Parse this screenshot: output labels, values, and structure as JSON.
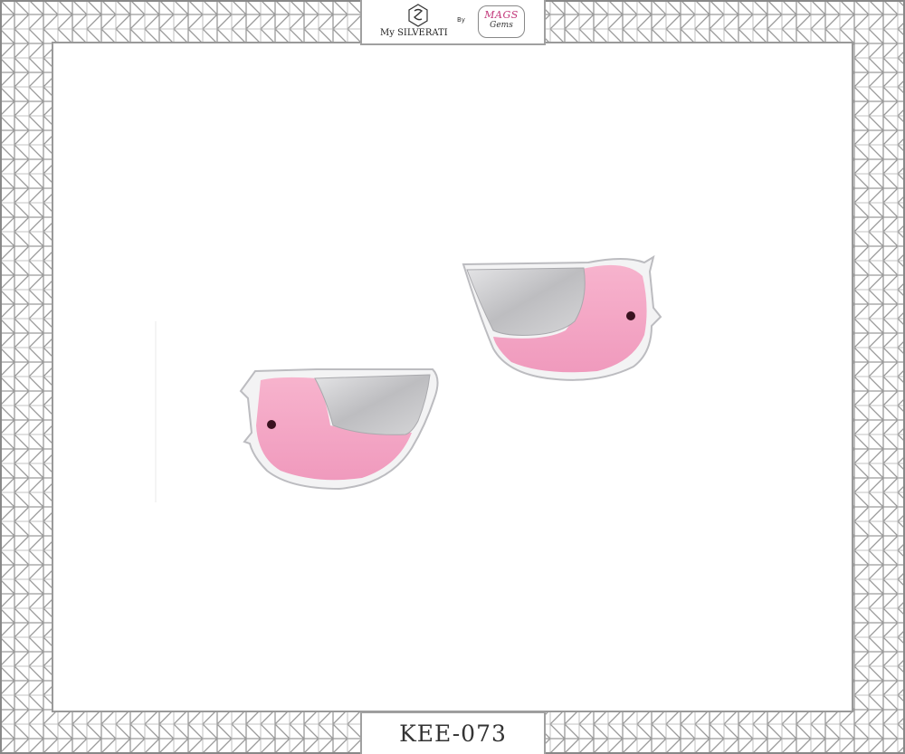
{
  "brand": {
    "name": "My SILVERATI",
    "by": "By",
    "partner_top": "MAGS",
    "partner_bottom": "Gems"
  },
  "product": {
    "sku": "KEE-073",
    "enamel_color": "#f4a6c4",
    "silver_color": "#c9c9cb",
    "frame_color": "#9a9a9a"
  }
}
